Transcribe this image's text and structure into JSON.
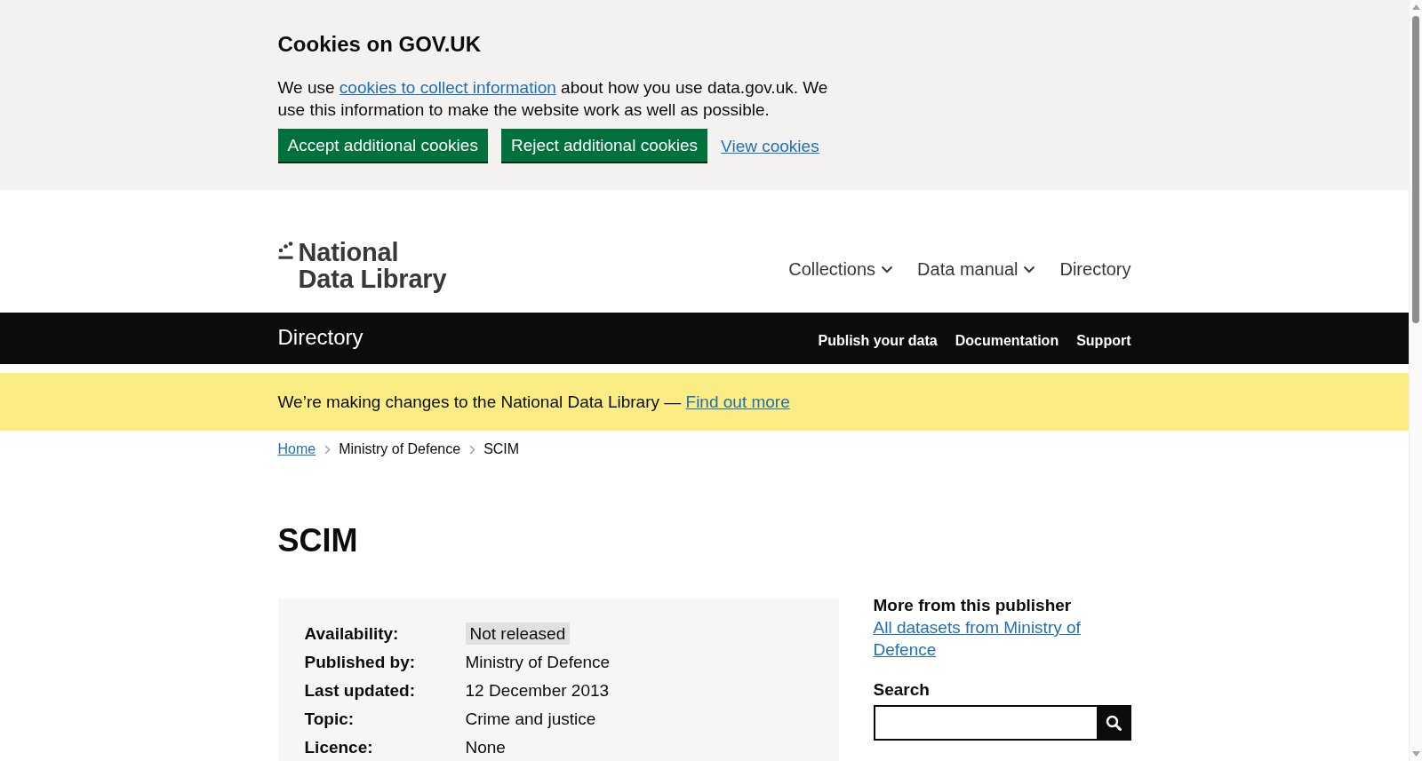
{
  "cookie_banner": {
    "title": "Cookies on GOV.UK",
    "message": {
      "before": "We use ",
      "link": "cookies to collect information",
      "after": " about how you use data.gov.uk. We use this information to make the website work as well as possible."
    },
    "buttons": [
      {
        "label": "Accept additional cookies",
        "kind": "primary"
      },
      {
        "label": "Reject additional cookies",
        "kind": "primary"
      },
      {
        "label": "View cookies",
        "kind": "link"
      }
    ]
  },
  "header": {
    "logo": {
      "lines": [
        "National",
        "Data Library"
      ]
    },
    "nav": [
      {
        "label": "Collections",
        "has_menu": true
      },
      {
        "label": "Data manual",
        "has_menu": true
      },
      {
        "label": "Directory",
        "has_menu": false
      }
    ]
  },
  "service_bar": {
    "title": "Directory",
    "links": [
      "Publish your data",
      "Documentation",
      "Support"
    ]
  },
  "notice": {
    "text": "We’re making changes to the National Data Library — ",
    "link": "Find out more"
  },
  "breadcrumbs": [
    {
      "label": "Home",
      "kind": "link"
    },
    {
      "label": "Ministry of Defence",
      "kind": "text"
    },
    {
      "label": "SCIM",
      "kind": "text"
    }
  ],
  "title": "SCIM",
  "summary": [
    {
      "label": "Availability:",
      "value": "Not released",
      "kind": "tag"
    },
    {
      "label": "Published by:",
      "value": "Ministry of Defence",
      "kind": "text"
    },
    {
      "label": "Last updated:",
      "value": "12 December 2013",
      "kind": "text"
    },
    {
      "label": "Topic:",
      "value": "Crime and justice",
      "kind": "text"
    },
    {
      "label": "Licence:",
      "value": "None",
      "kind": "text"
    }
  ],
  "sidebar": {
    "publisher_heading": "More from this publisher",
    "publisher_link": "All datasets from Ministry of Defence",
    "search_label": "Search"
  }
}
